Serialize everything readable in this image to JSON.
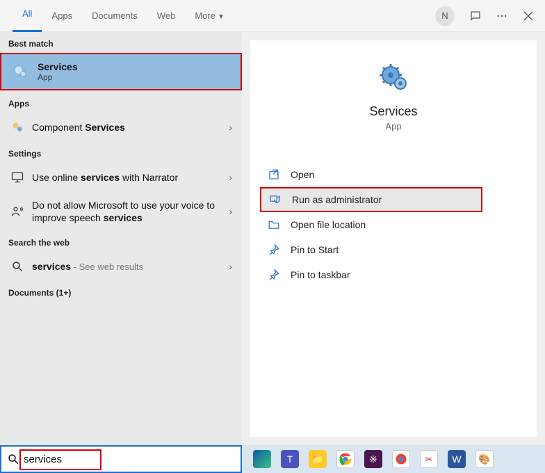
{
  "tabs": {
    "all": "All",
    "apps": "Apps",
    "documents": "Documents",
    "web": "Web",
    "more": "More"
  },
  "user_initial": "N",
  "left": {
    "best_match_label": "Best match",
    "best_match_title": "Services",
    "best_match_sub": "App",
    "apps_label": "Apps",
    "component_prefix": "Component ",
    "component_bold": "Services",
    "settings_label": "Settings",
    "setting1_prefix": "Use online ",
    "setting1_bold": "services",
    "setting1_suffix": " with Narrator",
    "setting2_prefix": "Do not allow Microsoft to use your voice to improve speech ",
    "setting2_bold": "services",
    "search_web_label": "Search the web",
    "web_bold": "services",
    "web_suffix": " - See web results",
    "documents_label": "Documents (1+)"
  },
  "detail": {
    "title": "Services",
    "sub": "App",
    "open": "Open",
    "run_admin": "Run as administrator",
    "open_loc": "Open file location",
    "pin_start": "Pin to Start",
    "pin_taskbar": "Pin to taskbar"
  },
  "search_value": "services",
  "taskbar_icons": [
    "edge",
    "teams",
    "explorer",
    "chrome",
    "slack",
    "chrome2",
    "snip",
    "word",
    "paint"
  ]
}
